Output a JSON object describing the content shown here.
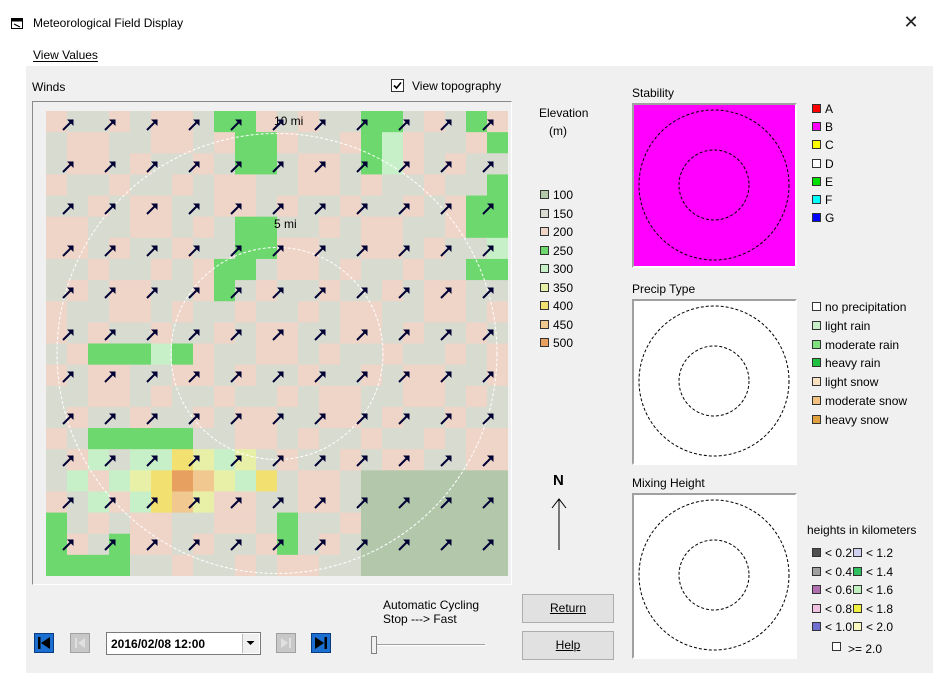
{
  "window": {
    "title": "Meteorological Field Display"
  },
  "menu": {
    "view_values": "View Values"
  },
  "winds": {
    "label": "Winds",
    "view_topography_label": "View topography",
    "view_topography_checked": true,
    "ring_labels": [
      "10 mi",
      "5 mi"
    ]
  },
  "elevation": {
    "title_line1": "Elevation",
    "title_line2": "(m)",
    "items": [
      {
        "value": "100",
        "color": "#b3c8aa"
      },
      {
        "value": "150",
        "color": "#d8dbd0"
      },
      {
        "value": "200",
        "color": "#efd4c8"
      },
      {
        "value": "250",
        "color": "#6dd86d"
      },
      {
        "value": "300",
        "color": "#c8f0c8"
      },
      {
        "value": "350",
        "color": "#e8f0a8"
      },
      {
        "value": "400",
        "color": "#f2e070"
      },
      {
        "value": "450",
        "color": "#f0c890"
      },
      {
        "value": "500",
        "color": "#e8a060"
      }
    ]
  },
  "compass": {
    "label": "N"
  },
  "stability": {
    "label": "Stability",
    "fill": "#ff00ff",
    "classes": [
      {
        "label": "A",
        "color": "#ff0000"
      },
      {
        "label": "B",
        "color": "#ff00ff"
      },
      {
        "label": "C",
        "color": "#ffff00"
      },
      {
        "label": "D",
        "color": "#ffffff"
      },
      {
        "label": "E",
        "color": "#00e000"
      },
      {
        "label": "F",
        "color": "#00ffff"
      },
      {
        "label": "G",
        "color": "#0000ff"
      }
    ]
  },
  "precip": {
    "label": "Precip Type",
    "types": [
      {
        "label": "no precipitation",
        "color": "#ffffff"
      },
      {
        "label": "light rain",
        "color": "#c8f0c8"
      },
      {
        "label": "moderate rain",
        "color": "#80e080"
      },
      {
        "label": "heavy rain",
        "color": "#20c040"
      },
      {
        "label": "light snow",
        "color": "#f8e0c0"
      },
      {
        "label": "moderate snow",
        "color": "#f0c080"
      },
      {
        "label": "heavy snow",
        "color": "#e0a040"
      }
    ]
  },
  "mixing": {
    "label": "Mixing Height",
    "heights_label": "heights in kilometers",
    "items": [
      {
        "label": "< 0.2",
        "color": "#505050"
      },
      {
        "label": "< 1.2",
        "color": "#d0d0f0"
      },
      {
        "label": "< 0.4",
        "color": "#a0a0a0"
      },
      {
        "label": "< 1.4",
        "color": "#30c060"
      },
      {
        "label": "< 0.6",
        "color": "#b070b0"
      },
      {
        "label": "< 1.6",
        "color": "#c0f0c0"
      },
      {
        "label": "< 0.8",
        "color": "#f0c0e0"
      },
      {
        "label": "< 1.8",
        "color": "#f0f040"
      },
      {
        "label": "< 1.0",
        "color": "#7070d0"
      },
      {
        "label": "< 2.0",
        "color": "#f8f8c0"
      }
    ],
    "last": {
      "label": ">= 2.0",
      "color": "#ffffff"
    }
  },
  "controls": {
    "date_value": "2016/02/08 12:00",
    "cycling_line1": "Automatic Cycling",
    "cycling_line2": "Stop ---> Fast",
    "return_label": "Return",
    "help_label": "Help"
  }
}
